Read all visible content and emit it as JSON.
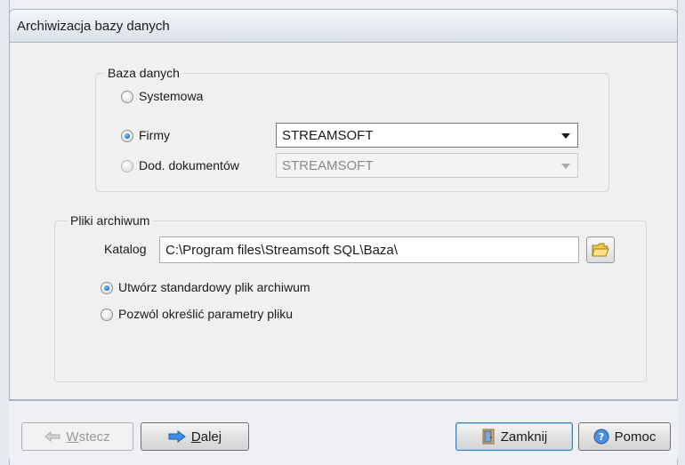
{
  "window": {
    "title": "Archiwizacja bazy danych"
  },
  "database_group": {
    "legend": "Baza danych",
    "options": [
      {
        "label": "Systemowa",
        "checked": false
      },
      {
        "label": "Firmy",
        "checked": true
      },
      {
        "label": "Dod. dokumentów",
        "checked": false
      }
    ],
    "firm_select_value": "STREAMSOFT",
    "docs_select_value": "STREAMSOFT"
  },
  "archive_group": {
    "legend": "Pliki archiwum",
    "catalog_label": "Katalog",
    "catalog_value": "C:\\Program files\\Streamsoft SQL\\Baza\\",
    "options": [
      {
        "label": "Utwórz standardowy plik archiwum",
        "checked": true
      },
      {
        "label": "Pozwól określić parametry pliku",
        "checked": false
      }
    ]
  },
  "footer": {
    "back_label_u": "W",
    "back_label_rest": "stecz",
    "next_label_u": "D",
    "next_label_rest": "alej",
    "close_label": "Zamknij",
    "help_label": "Pomoc"
  }
}
